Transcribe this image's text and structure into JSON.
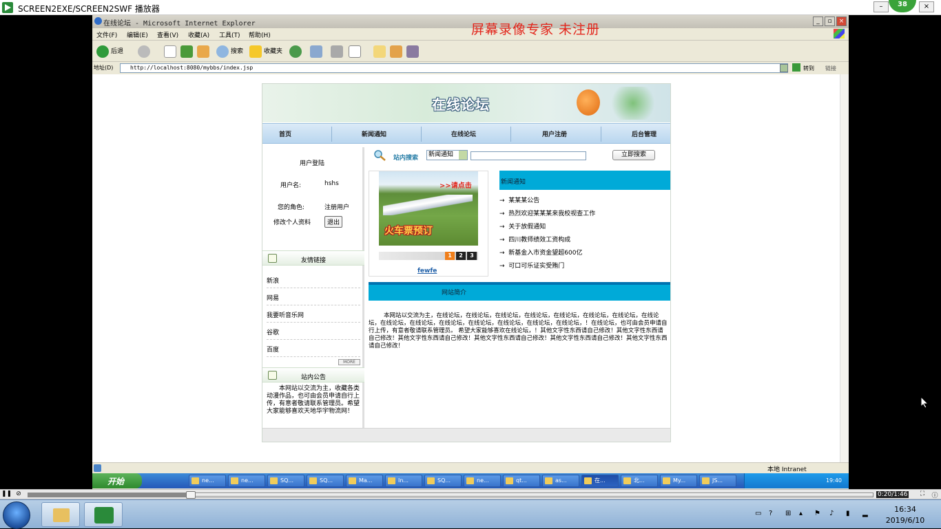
{
  "player": {
    "title": "SCREEN2EXE/SCREEN2SWF 播放器",
    "badge": "38",
    "time": "0:20/1:46",
    "progress_fraction": 0.19
  },
  "ie": {
    "title": "在线论坛 - Microsoft Internet Explorer",
    "watermark": "屏幕录像专家  未注册",
    "menu": [
      "文件(F)",
      "编辑(E)",
      "查看(V)",
      "收藏(A)",
      "工具(T)",
      "帮助(H)"
    ],
    "toolbar": {
      "back": "后退",
      "search": "搜索",
      "favorites": "收藏夹"
    },
    "address_label": "地址(D)",
    "address_value": "http://localhost:8080/mybbs/index.jsp",
    "go_label": "转到",
    "links_label": "链接",
    "status_zone": "本地 Intranet"
  },
  "forum": {
    "banner_title": "在线论坛",
    "nav": [
      "首页",
      "新闻通知",
      "在线论坛",
      "用户注册",
      "后台管理"
    ],
    "login": {
      "heading": "用户登陆",
      "username_label": "用户名:",
      "username_value": "hshs",
      "role_label": "您的角色:",
      "role_value": "注册用户",
      "edit_profile": "修改个人资料",
      "logout_button": "退出"
    },
    "links_heading": "友情链接",
    "links": [
      "新浪",
      "网易",
      "我要听音乐网",
      "谷歌",
      "百度"
    ],
    "more_label": "MORE",
    "notice_heading": "站内公告",
    "notice_text": "本网站以交流为主，收藏各类动漫作品，也可由会员申请自行上传，有意者敬请联系管理员。希望大家能够喜欢天地华宇物流网！",
    "search": {
      "label": "站内搜索",
      "selected": "新闻通知",
      "input_value": "",
      "button": "立即搜索"
    },
    "slideshow": {
      "promo": ">>请点击",
      "ticket": "火车票预订",
      "pages": [
        "1",
        "2",
        "3"
      ],
      "active_page": 0,
      "caption": "fewfe"
    },
    "news_heading": "新闻通知",
    "news": [
      "某某某公告",
      "热烈欢迎某某某来我校视查工作",
      "关于放假通知",
      "四川教师绩效工资构成",
      "新基金入市资金望超600亿",
      "可口可乐证实受贿门"
    ],
    "intro_heading": "网站简介",
    "intro_text": "本网站以交流为主，在线论坛，在线论坛，在线论坛，在线论坛，在线论坛，在线论坛，在线论坛，在线论坛，在线论坛，在线论坛，在线论坛，在线论坛，在线论坛，在线论坛，在线论坛，！在线论坛，也可由会员申请自行上传，有意者敬请联系管理员。     希望大家能够喜欢在线论坛，！其他文字性东西请自己修改！其他文字性东西请自己修改！其他文字性东西请自己修改！其他文字性东西请自己修改！其他文字性东西请自己修改！其他文字性东西请自己修改！"
  },
  "xp_taskbar": {
    "start": "开始",
    "buttons": [
      "ne...",
      "ne...",
      "SQ...",
      "SQ...",
      "Ma...",
      "In...",
      "SQ...",
      "ne...",
      "qt...",
      "as...",
      "在...",
      "北...",
      "My...",
      "JS..."
    ],
    "active_index": 10,
    "clock": "19:40"
  },
  "win7": {
    "clock_time": "16:34",
    "clock_date": "2019/6/10"
  }
}
